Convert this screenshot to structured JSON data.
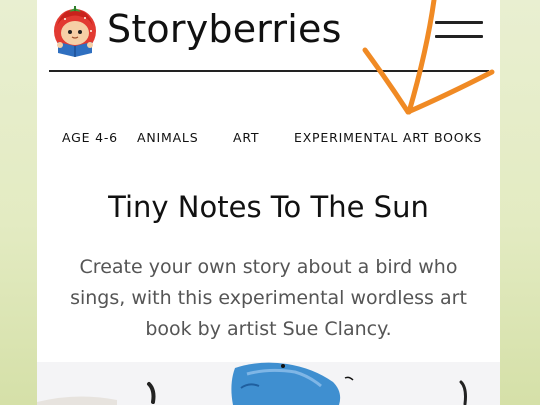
{
  "header": {
    "brand": "Storyberries",
    "menu_icon": "hamburger-menu-icon",
    "logo_icon": "strawberry-reader-logo"
  },
  "categories": [
    "AGE 4-6",
    "ANIMALS",
    "ART",
    "EXPERIMENTAL ART BOOKS"
  ],
  "story": {
    "title": "Tiny Notes To The Sun",
    "description": "Create your own story about a bird who sings, with this experimental wordless art book by artist Sue Clancy."
  },
  "colors": {
    "background": "#e6edc6",
    "annotation_arrow": "#f08a24",
    "text": "#111111",
    "description_text": "#555555",
    "bird_blue": "#3f8fd0"
  }
}
